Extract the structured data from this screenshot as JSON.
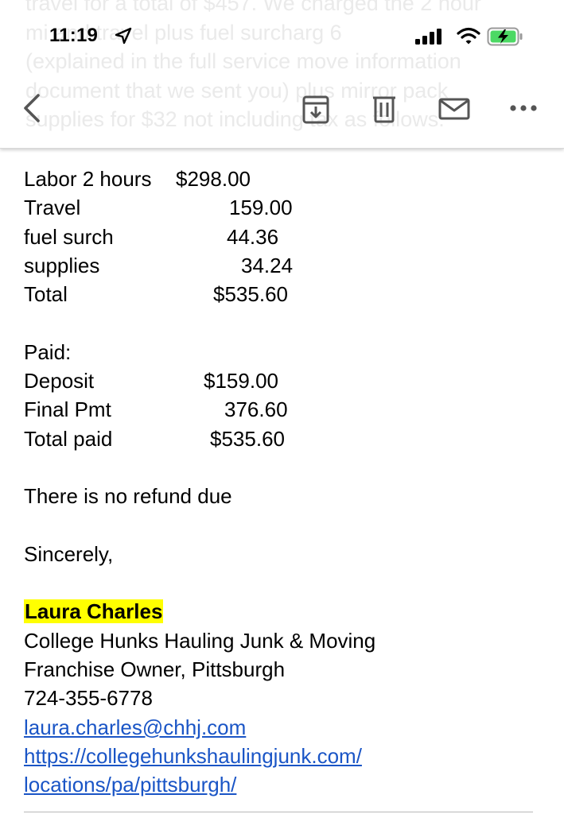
{
  "status_bar": {
    "time": "11:19",
    "icons": [
      "location-arrow-icon",
      "cellular-signal-icon",
      "wifi-icon",
      "battery-charging-icon"
    ],
    "battery_color": "#4cd964"
  },
  "background_text": {
    "lines": [
      "travel for a total of $457.  We charged the 2 hour",
      "mi       and travel plus fuel surcharg            6",
      "(explained in the full service move information",
      "document that we sent you) plus mirror pack",
      "supplies for $32 not including tax as follows:"
    ]
  },
  "toolbar": {
    "icons": [
      "back-chevron-icon",
      "archive-icon",
      "trash-icon",
      "mark-unread-icon",
      "more-icon"
    ],
    "accent_color": "#555555"
  },
  "charges": [
    {
      "label": "Labor 2 hours",
      "value": "$298.00"
    },
    {
      "label": "Travel",
      "value": "159.00"
    },
    {
      "label": "fuel surch",
      "value": "44.36"
    },
    {
      "label": "supplies",
      "value": "34.24"
    },
    {
      "label": "Total",
      "value": "$535.60"
    }
  ],
  "paid": {
    "heading": "Paid:",
    "rows": [
      {
        "label": "Deposit",
        "value": "$159.00"
      },
      {
        "label": "Final Pmt",
        "value": "376.60"
      },
      {
        "label": "Total paid",
        "value": "$535.60"
      }
    ]
  },
  "message": "There is no refund due",
  "closing": "Sincerely,",
  "signature": {
    "name": "Laura Charles",
    "company": "College Hunks Hauling Junk & Moving",
    "title": "Franchise Owner, Pittsburgh",
    "phone": "724-355-6778",
    "email": "laura.charles@chhj.com",
    "url_line1": "https://collegehunkshaulingjunk.com/",
    "url_line2": "locations/pa/pittsburgh/",
    "highlight_color": "#ffff00",
    "link_color": "#1a55c6"
  }
}
